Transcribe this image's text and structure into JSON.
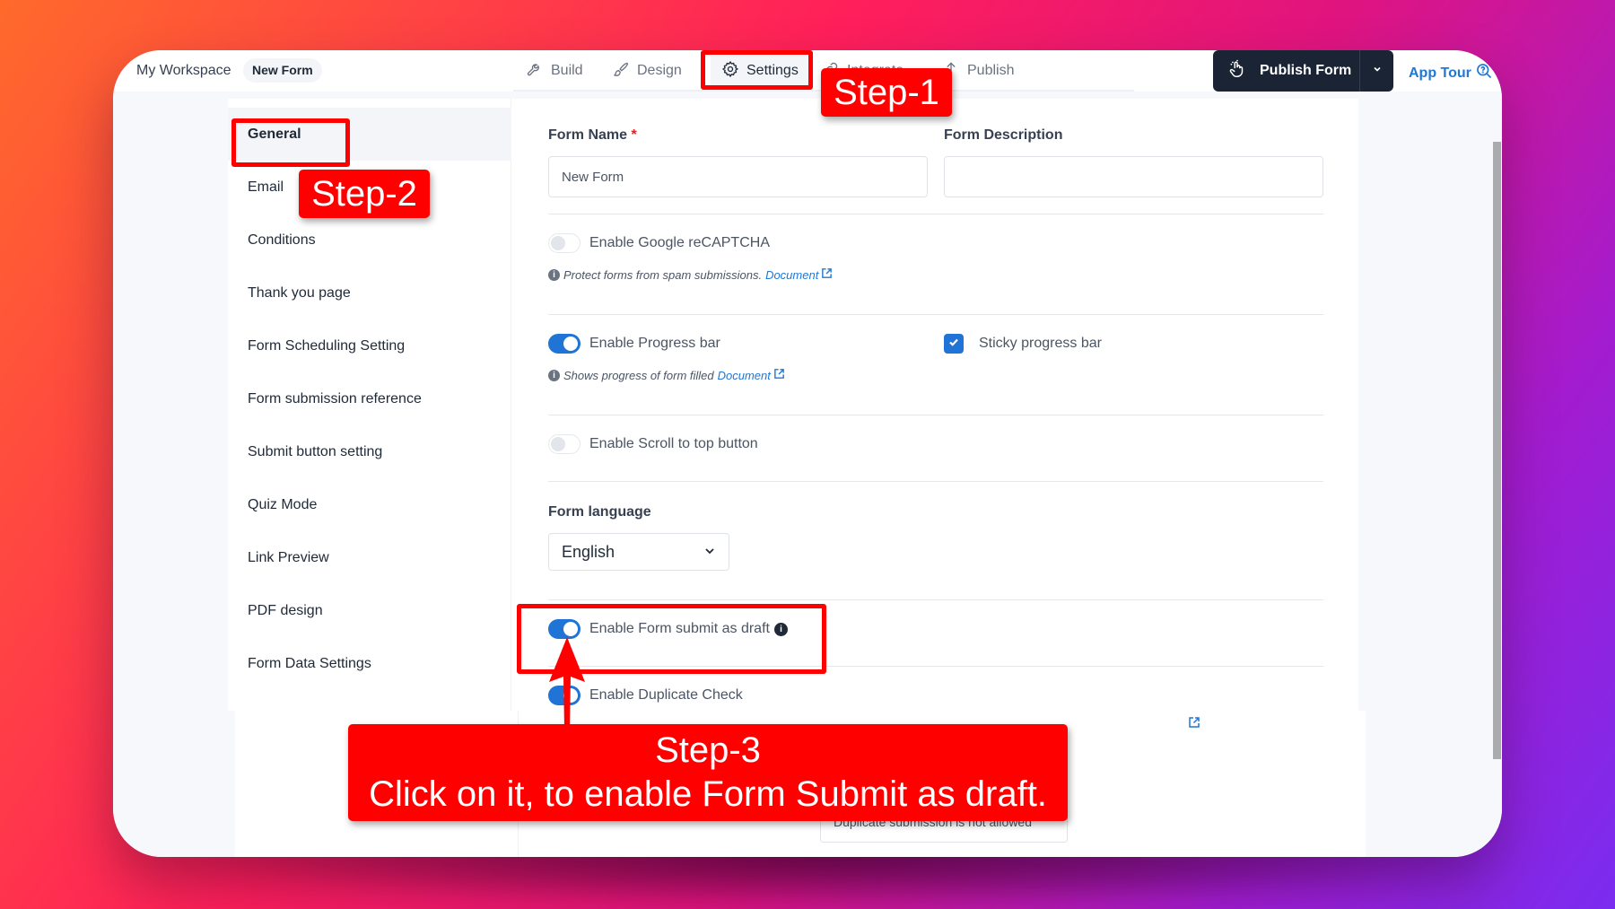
{
  "header": {
    "workspace": "My Workspace",
    "form_name_chip": "New Form",
    "tabs": [
      {
        "label": "Build",
        "icon": "wrench-icon"
      },
      {
        "label": "Design",
        "icon": "brush-icon"
      },
      {
        "label": "Settings",
        "icon": "gear-icon",
        "active": true
      },
      {
        "label": "Integrate",
        "icon": "link-icon"
      },
      {
        "label": "Publish",
        "icon": "upload-icon"
      }
    ],
    "publish_button": "Publish Form",
    "app_tour": "App Tour"
  },
  "sidebar": {
    "items": [
      {
        "label": "General",
        "active": true
      },
      {
        "label": "Email"
      },
      {
        "label": "Conditions"
      },
      {
        "label": "Thank you page"
      },
      {
        "label": "Form Scheduling Setting"
      },
      {
        "label": "Form submission reference"
      },
      {
        "label": "Submit button setting"
      },
      {
        "label": "Quiz Mode"
      },
      {
        "label": "Link Preview"
      },
      {
        "label": "PDF design"
      },
      {
        "label": "Form Data Settings"
      }
    ]
  },
  "general": {
    "form_name_label": "Form Name",
    "required_mark": "*",
    "form_name_value": "New Form",
    "form_description_label": "Form Description",
    "form_description_value": "",
    "recaptcha": {
      "label": "Enable Google reCAPTCHA",
      "enabled": false,
      "hint": "Protect forms from spam submissions.",
      "link": "Document"
    },
    "progress_bar": {
      "label": "Enable Progress bar",
      "enabled": true,
      "hint": "Shows progress of form filled",
      "link": "Document"
    },
    "sticky_progress": {
      "label": "Sticky progress bar",
      "checked": true
    },
    "scroll_top": {
      "label": "Enable Scroll to top button",
      "enabled": false
    },
    "language_label": "Form language",
    "language_value": "English",
    "submit_draft": {
      "label": "Enable Form submit as draft",
      "enabled": true
    },
    "duplicate_check": {
      "label": "Enable Duplicate Check",
      "enabled": true,
      "message_value": "Duplicate submission is not allowed"
    }
  },
  "annotations": {
    "step1": "Step-1",
    "step2": "Step-2",
    "step3_title": "Step-3",
    "step3_text": "Click on it, to enable Form Submit as draft.",
    "color": "#ff0000"
  },
  "colors": {
    "accent": "#1f74d6",
    "publish_bg": "#1b2434",
    "link": "#1f77d6"
  }
}
